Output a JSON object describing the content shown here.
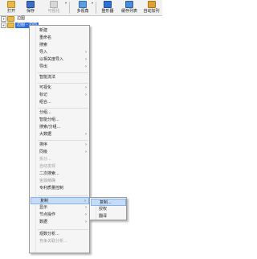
{
  "toolbar": {
    "open": "打开",
    "save": "保存",
    "draw": "可视化",
    "multi_view": "多视角",
    "filter": "整形器",
    "cache_list": "缓存列表",
    "auto_layout": "自动加列"
  },
  "tree": {
    "nodes": [
      {
        "label": "边图"
      },
      {
        "label": "边图 - 边向"
      }
    ]
  },
  "context_menu": {
    "items": [
      {
        "label": "新建"
      },
      {
        "label": "重命名"
      },
      {
        "label": "搜索"
      },
      {
        "label": "导入"
      },
      {
        "label": "以相关度导入"
      },
      {
        "label": "导出"
      },
      {
        "label": "智能流法"
      },
      {
        "label": "可视化"
      },
      {
        "label": "标记"
      },
      {
        "label": "组合..."
      },
      {
        "label": "分组..."
      },
      {
        "label": "智能分组..."
      },
      {
        "label": "搜索/分组..."
      },
      {
        "label": "大数据"
      },
      {
        "label": "排序"
      },
      {
        "label": "同级"
      },
      {
        "label": "拆分..."
      },
      {
        "label": "自动发现"
      },
      {
        "label": "二次搜索..."
      },
      {
        "label": "金融精确"
      },
      {
        "label": "专利质量控制"
      },
      {
        "label": "复制"
      },
      {
        "label": "显示"
      },
      {
        "label": "节点操作"
      },
      {
        "label": "数据"
      },
      {
        "label": "观数分析..."
      },
      {
        "label": "竞争关联分析..."
      }
    ]
  },
  "submenu": {
    "items": [
      {
        "label": "复制..."
      },
      {
        "label": "授权"
      },
      {
        "label": "翻译"
      }
    ]
  },
  "colors": {
    "selection": "#2f6fdc",
    "menu_highlight": "#c5dcf8"
  }
}
